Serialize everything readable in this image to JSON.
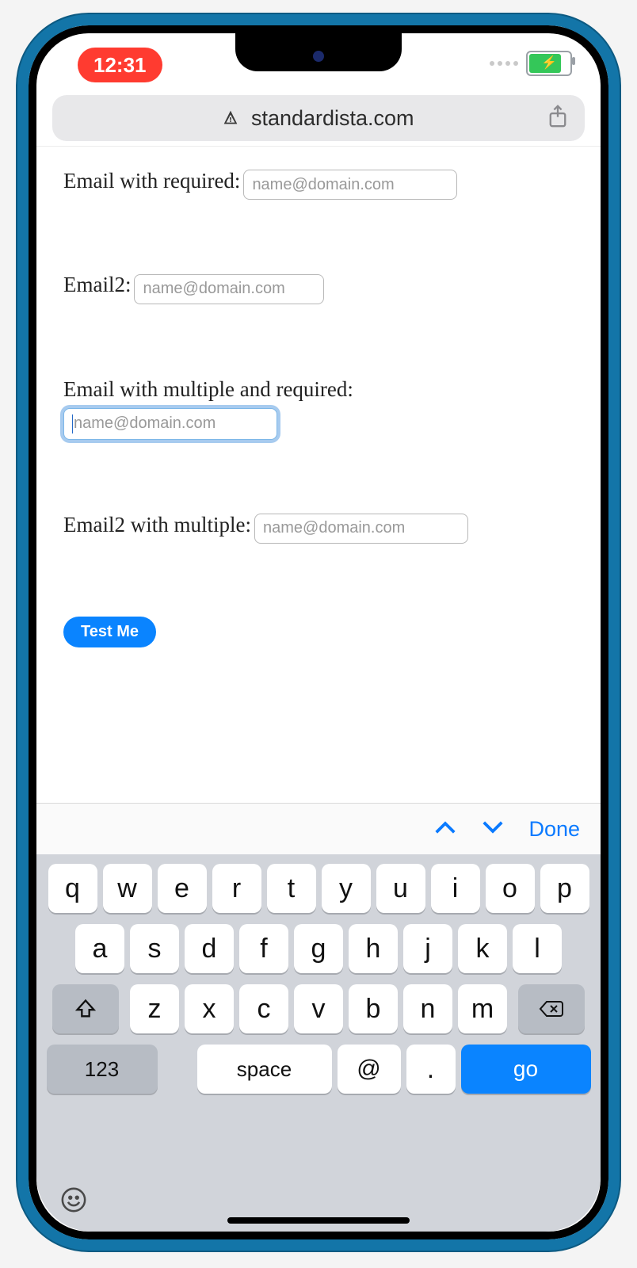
{
  "status": {
    "time": "12:31"
  },
  "address_bar": {
    "domain": "standardista.com"
  },
  "form": {
    "fields": [
      {
        "label": "Email with required:",
        "placeholder": "name@domain.com"
      },
      {
        "label": "Email2:",
        "placeholder": "name@domain.com"
      },
      {
        "label": "Email with multiple and required:",
        "placeholder": "name@domain.com"
      },
      {
        "label": "Email2 with multiple:",
        "placeholder": "name@domain.com"
      }
    ],
    "submit_label": "Test Me"
  },
  "keyboard_accessory": {
    "done_label": "Done"
  },
  "keyboard": {
    "row1": [
      "q",
      "w",
      "e",
      "r",
      "t",
      "y",
      "u",
      "i",
      "o",
      "p"
    ],
    "row2": [
      "a",
      "s",
      "d",
      "f",
      "g",
      "h",
      "j",
      "k",
      "l"
    ],
    "row3": [
      "z",
      "x",
      "c",
      "v",
      "b",
      "n",
      "m"
    ],
    "num_label": "123",
    "space_label": "space",
    "at_label": "@",
    "dot_label": ".",
    "go_label": "go"
  }
}
